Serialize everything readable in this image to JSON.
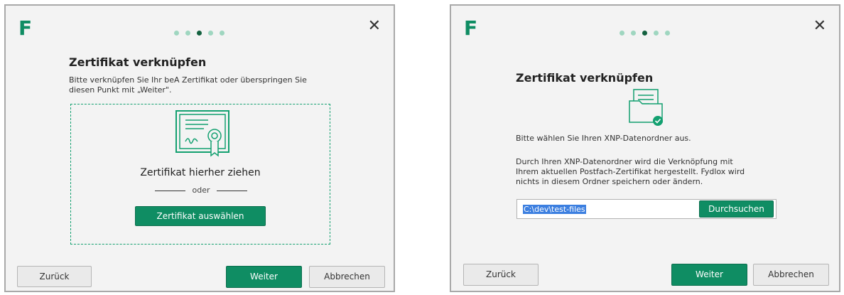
{
  "dialog1": {
    "logo": "F",
    "title": "Zertifikat verknüpfen",
    "description": "Bitte verknüpfen Sie Ihr beA Zertifikat oder überspringen Sie diesen Punkt mit „Weiter\".",
    "drop_text": "Zertifikat hierher ziehen",
    "or_text": "oder",
    "select_button": "Zertifikat auswählen",
    "back_button": "Zurück",
    "next_button": "Weiter",
    "cancel_button": "Abbrechen",
    "steps_total": 5,
    "step_active": 3
  },
  "dialog2": {
    "logo": "F",
    "title": "Zertifikat verknüpfen",
    "instruction": "Bitte wählen Sie Ihren XNP-Datenordner aus.",
    "explanation": "Durch Ihren XNP-Datenordner wird die Verknöpfung mit Ihrem aktuellen Postfach-Zertifikat hergestellt. Fydlox wird nichts in diesem Ordner speichern oder ändern.",
    "path_value": "C:\\dev\\test-files",
    "browse_button": "Durchsuchen",
    "back_button": "Zurück",
    "next_button": "Weiter",
    "cancel_button": "Abbrechen",
    "steps_total": 5,
    "step_active": 3
  },
  "colors": {
    "brand_green": "#0f8d63",
    "dot_inactive": "#9fd6c0",
    "dot_active": "#13613f",
    "dialog_bg": "#f3f3f3"
  },
  "icons": {
    "certificate": "certificate-icon",
    "folder": "folder-check-icon",
    "close": "close-icon"
  }
}
